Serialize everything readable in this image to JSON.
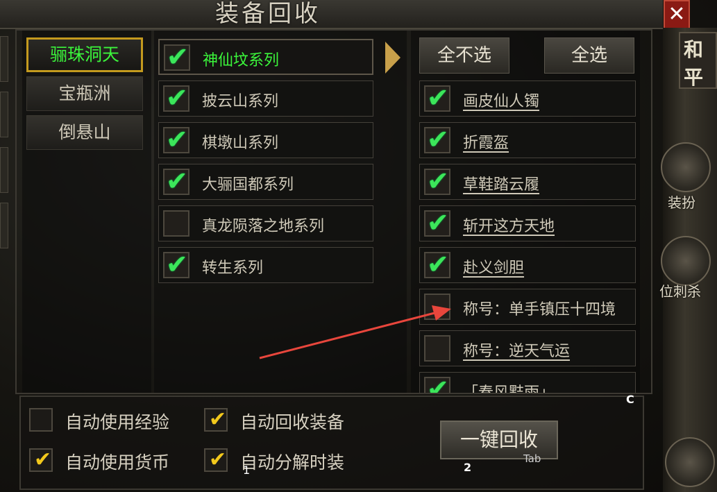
{
  "window": {
    "title": "装备回收",
    "close_label": "✕"
  },
  "regions": [
    {
      "label": "骊珠洞天",
      "active": true
    },
    {
      "label": "宝瓶洲",
      "active": false
    },
    {
      "label": "倒悬山",
      "active": false
    }
  ],
  "series": [
    {
      "label": "神仙坟系列",
      "checked": true,
      "selected": true
    },
    {
      "label": "披云山系列",
      "checked": true,
      "selected": false
    },
    {
      "label": "棋墩山系列",
      "checked": true,
      "selected": false
    },
    {
      "label": "大骊国都系列",
      "checked": true,
      "selected": false
    },
    {
      "label": "真龙陨落之地系列",
      "checked": false,
      "selected": false
    },
    {
      "label": "转生系列",
      "checked": true,
      "selected": false
    }
  ],
  "controls": {
    "deselect_all": "全不选",
    "select_all": "全选"
  },
  "items": [
    {
      "label": "画皮仙人镯",
      "checked": true
    },
    {
      "label": "折霞盔",
      "checked": true
    },
    {
      "label": "草鞋踏云履",
      "checked": true
    },
    {
      "label": "斩开这方天地",
      "checked": true
    },
    {
      "label": "赴义剑胆",
      "checked": true
    },
    {
      "label": "称号：单手镇压十四境",
      "checked": false
    },
    {
      "label": "称号：逆天气运",
      "checked": false
    },
    {
      "label": "「春风黠雨」",
      "checked": true
    }
  ],
  "options": [
    {
      "label": "自动使用经验",
      "checked": false
    },
    {
      "label": "自动回收装备",
      "checked": true
    },
    {
      "label": "自动使用货币",
      "checked": true
    },
    {
      "label": "自动分解时装",
      "checked": true
    }
  ],
  "recycle_button": "一键回收",
  "hints": {
    "c": "C",
    "tab": "Tab",
    "one": "1",
    "two": "2"
  },
  "hud": {
    "tag_chars": [
      "和",
      "平"
    ],
    "skill1": "装扮",
    "skill2": "位刺杀"
  },
  "colors": {
    "selected_text": "#3bf53b",
    "check_green": "#3ce65a",
    "check_yellow": "#f2c81c",
    "active_border": "#c49a1e"
  }
}
